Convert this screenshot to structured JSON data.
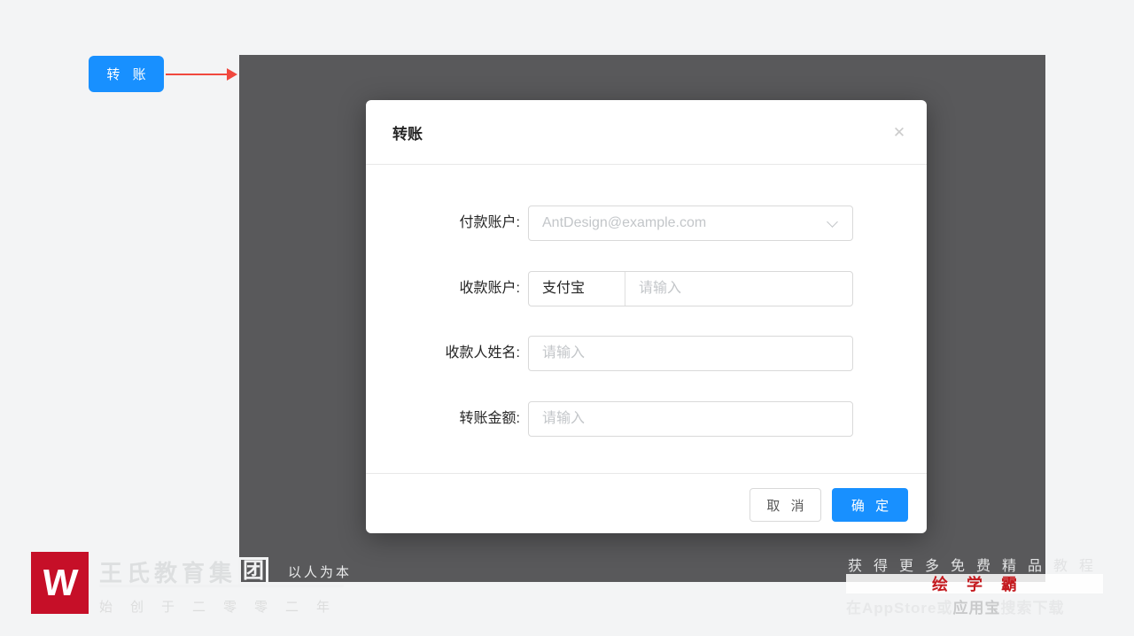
{
  "colors": {
    "page_bg": "#f3f4f5",
    "panel_bg": "#59595b",
    "primary_blue": "#1890ff",
    "arrow_red": "#f0483e",
    "brand_red": "#c60f28",
    "input_border": "#d9d9d9",
    "placeholder_gray": "#c3c6c9"
  },
  "trigger": {
    "label": "转 账"
  },
  "icons": {
    "close": "✕",
    "chevron_down": "chevron-down"
  },
  "modal": {
    "title": "转账",
    "form": {
      "rows": [
        {
          "label": "付款账户:",
          "type": "select",
          "placeholder": "AntDesign@example.com"
        },
        {
          "label": "收款账户:",
          "type": "compound",
          "select_value": "支付宝",
          "placeholder": "请输入"
        },
        {
          "label": "收款人姓名:",
          "type": "input",
          "placeholder": "请输入"
        },
        {
          "label": "转账金额:",
          "type": "input",
          "placeholder": "请输入"
        }
      ]
    },
    "footer": {
      "cancel_label": "取 消",
      "ok_label": "确 定"
    }
  },
  "branding_left": {
    "logo_letter": "W",
    "company_name": "王氏教育集",
    "company_boxed_char": "团",
    "slogan": "以人为本",
    "subtitle": "始创于二零零二年"
  },
  "branding_right": {
    "line1": "获得更多免费精品教程",
    "app_name": "绘 学 霸",
    "line3_prefix": "在AppStore",
    "line3_mid": "或",
    "line3_highlight": "应用宝",
    "line3_suffix": "搜索下载"
  }
}
